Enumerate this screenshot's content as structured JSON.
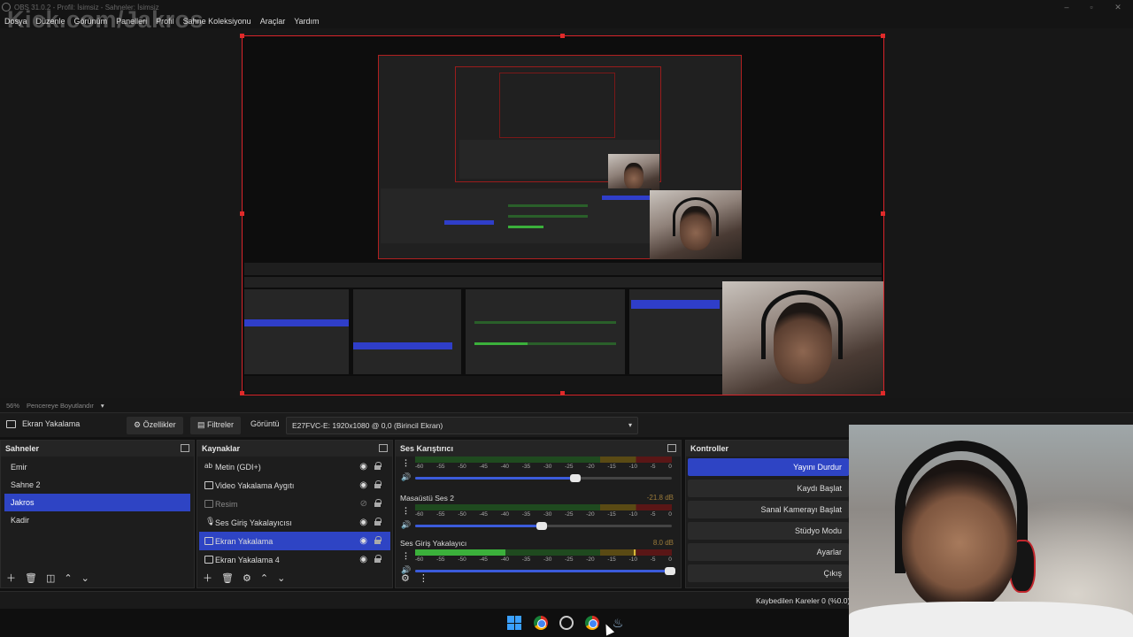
{
  "window": {
    "title": "OBS 31.0.2 - Profil: İsimsiz - Sahneler: İsimsiz",
    "watermark": "Kick.com/Jakros"
  },
  "menu": [
    "Dosya",
    "Düzenle",
    "Görünüm",
    "Panelleri",
    "Profil",
    "Sahne Koleksiyonu",
    "Araçlar",
    "Yardım"
  ],
  "zoom": {
    "level": "56%",
    "mode": "Pencereye Boyutlandır"
  },
  "source_toolbar": {
    "source_name": "Ekran Yakalama",
    "properties": "Özellikler",
    "filters": "Filtreler",
    "display_label": "Görüntü",
    "display_value": "E27FVC-E: 1920x1080 @ 0,0 (Birincil Ekran)"
  },
  "scenes": {
    "title": "Sahneler",
    "items": [
      "Emir",
      "Sahne 2",
      "Jakros",
      "Kadir"
    ],
    "selected": 2
  },
  "sources": {
    "title": "Kaynaklar",
    "items": [
      {
        "label": "Metin (GDI+)",
        "icon": "text-icon",
        "visible": true
      },
      {
        "label": "Video Yakalama Aygıtı",
        "icon": "camera-icon",
        "visible": true
      },
      {
        "label": "Resim",
        "icon": "image-icon",
        "visible": false
      },
      {
        "label": "Ses Giriş Yakalayıcısı",
        "icon": "microphone-icon",
        "visible": true
      },
      {
        "label": "Ekran Yakalama",
        "icon": "monitor-icon",
        "visible": true
      },
      {
        "label": "Ekran Yakalama 4",
        "icon": "monitor-icon",
        "visible": true
      }
    ],
    "selected": 4
  },
  "mixer": {
    "title": "Ses Karıştırıcı",
    "ticks": [
      "-60",
      "-55",
      "-50",
      "-45",
      "-40",
      "-35",
      "-30",
      "-25",
      "-20",
      "-15",
      "-10",
      "-5",
      "0"
    ],
    "channels": [
      {
        "name": "",
        "db": "",
        "level": 0.0,
        "volume": 0.63
      },
      {
        "name": "Masaüstü Ses 2",
        "db": "-21.8 dB",
        "level": 0.0,
        "volume": 0.5
      },
      {
        "name": "Ses Giriş Yakalayıcı",
        "db": "8.0 dB",
        "level": 0.35,
        "volume": 1.0
      }
    ]
  },
  "controls": {
    "title": "Kontroller",
    "buttons": [
      "Yayını Durdur",
      "Kaydı Başlat",
      "Sanal Kamerayı Başlat",
      "Stüdyo Modu",
      "Ayarlar",
      "Çıkış"
    ]
  },
  "status": {
    "dropped_frames": "Kaybedilen Kareler 0 (%0.0)"
  },
  "colors": {
    "accent": "#2e44c4",
    "selection_border": "#d8242a"
  }
}
